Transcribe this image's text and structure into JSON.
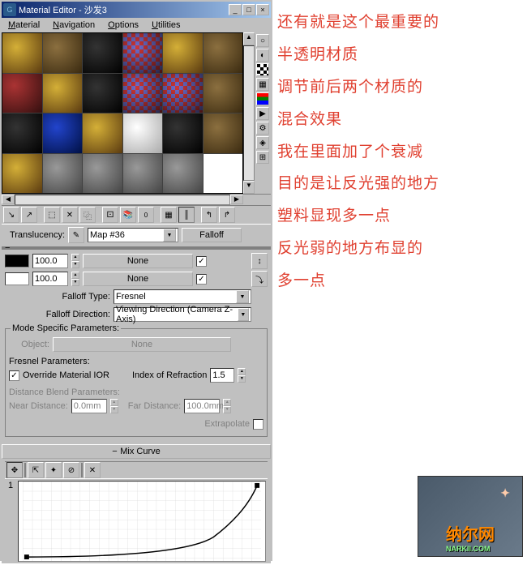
{
  "window": {
    "title": "Material Editor - 沙发3",
    "icon": "G"
  },
  "menu": {
    "material": "Material",
    "navigation": "Navigation",
    "options": "Options",
    "utilities": "Utilities"
  },
  "translucency": {
    "label": "Translucency:",
    "value": "Map #36",
    "type_button": "Falloff"
  },
  "falloff": {
    "color1_amount": "100.0",
    "color1_map": "None",
    "color1_enabled": "✓",
    "color2_amount": "100.0",
    "color2_map": "None",
    "color2_enabled": "✓",
    "type_label": "Falloff Type:",
    "type_value": "Fresnel",
    "direction_label": "Falloff Direction:",
    "direction_value": "Viewing Direction (Camera Z-Axis)"
  },
  "mode_params": {
    "title": "Mode Specific Parameters:",
    "object_label": "Object:",
    "object_value": "None",
    "fresnel_title": "Fresnel Parameters:",
    "override_label": "Override Material IOR",
    "override_checked": "✓",
    "ior_label": "Index of Refraction",
    "ior_value": "1.5",
    "distance_title": "Distance Blend Parameters:",
    "near_label": "Near Distance:",
    "near_value": "0.0mm",
    "far_label": "Far Distance:",
    "far_value": "100.0mm",
    "extrapolate_label": "Extrapolate"
  },
  "mix_curve": {
    "title": "Mix Curve",
    "y_label": "1"
  },
  "annotations": [
    "还有就是这个最重要的",
    "半透明材质",
    "调节前后两个材质的",
    "混合效果",
    "我在里面加了个衰减",
    "目的是让反光强的地方",
    "塑料显现多一点",
    "反光弱的地方布显的",
    "多一点"
  ],
  "watermark": "纳尔网",
  "watermark_sub": "NARKII.COM"
}
